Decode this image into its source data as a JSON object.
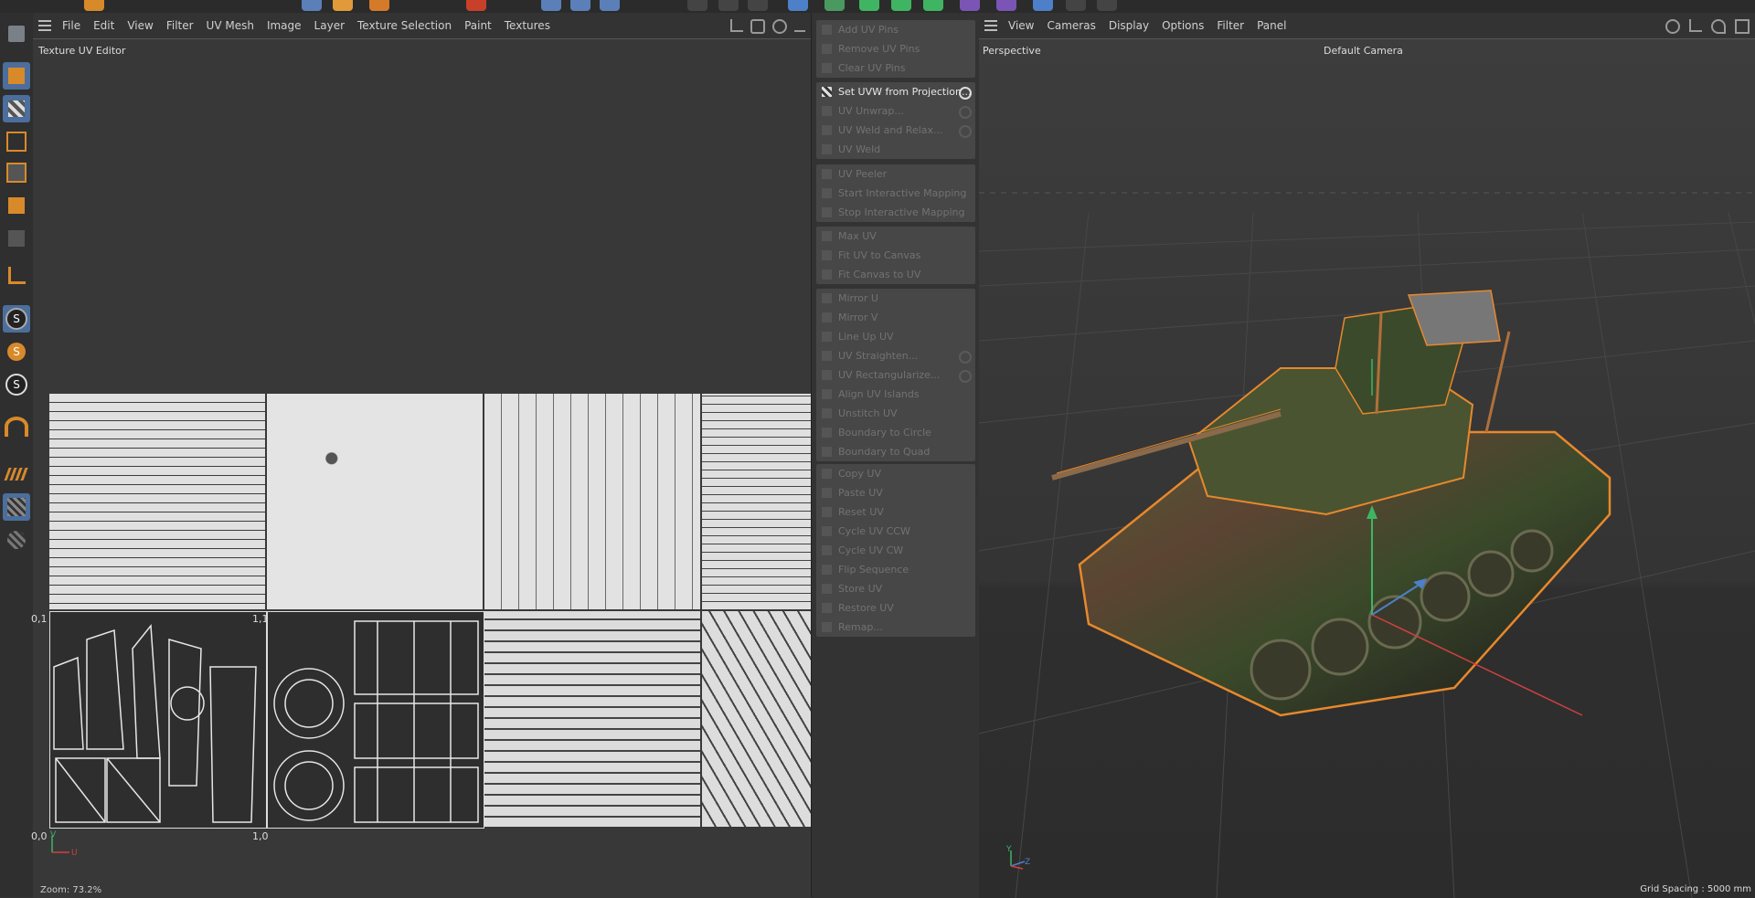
{
  "uv_editor": {
    "menu": [
      "File",
      "Edit",
      "View",
      "Filter",
      "UV Mesh",
      "Image",
      "Layer",
      "Texture Selection",
      "Paint",
      "Textures"
    ],
    "title": "Texture UV Editor",
    "zoom": "Zoom: 73.2%",
    "coords": {
      "origin": "0,0",
      "x1": "1,0",
      "y1": "0,1",
      "xy1": "1,1"
    },
    "axis_u": "U",
    "axis_v": "V"
  },
  "uv_commands": {
    "groups": [
      [
        {
          "label": "Add UV Pins",
          "enabled": false,
          "gear": false
        },
        {
          "label": "Remove UV Pins",
          "enabled": false,
          "gear": false
        },
        {
          "label": "Clear UV Pins",
          "enabled": false,
          "gear": false
        }
      ],
      [
        {
          "label": "Set UVW from Projection...",
          "enabled": true,
          "gear": true
        },
        {
          "label": "UV Unwrap...",
          "enabled": false,
          "gear": true
        },
        {
          "label": "UV Weld and Relax...",
          "enabled": false,
          "gear": true
        },
        {
          "label": "UV Weld",
          "enabled": false,
          "gear": false
        }
      ],
      [
        {
          "label": "UV Peeler",
          "enabled": false,
          "gear": false
        },
        {
          "label": "Start Interactive Mapping",
          "enabled": false,
          "gear": false
        },
        {
          "label": "Stop Interactive Mapping",
          "enabled": false,
          "gear": false
        }
      ],
      [
        {
          "label": "Max UV",
          "enabled": false,
          "gear": false
        },
        {
          "label": "Fit UV to Canvas",
          "enabled": false,
          "gear": false
        },
        {
          "label": "Fit Canvas to UV",
          "enabled": false,
          "gear": false
        }
      ],
      [
        {
          "label": "Mirror U",
          "enabled": false,
          "gear": false
        },
        {
          "label": "Mirror V",
          "enabled": false,
          "gear": false
        },
        {
          "label": "Line Up UV",
          "enabled": false,
          "gear": false
        },
        {
          "label": "UV Straighten...",
          "enabled": false,
          "gear": true
        },
        {
          "label": "UV Rectangularize...",
          "enabled": false,
          "gear": true
        },
        {
          "label": "Align UV Islands",
          "enabled": false,
          "gear": false
        },
        {
          "label": "Unstitch UV",
          "enabled": false,
          "gear": false
        },
        {
          "label": "Boundary to Circle",
          "enabled": false,
          "gear": false
        },
        {
          "label": "Boundary to Quad",
          "enabled": false,
          "gear": false
        }
      ],
      [
        {
          "label": "Copy UV",
          "enabled": false,
          "gear": false
        },
        {
          "label": "Paste UV",
          "enabled": false,
          "gear": false
        },
        {
          "label": "Reset UV",
          "enabled": false,
          "gear": false
        },
        {
          "label": "Cycle UV CCW",
          "enabled": false,
          "gear": false
        },
        {
          "label": "Cycle UV CW",
          "enabled": false,
          "gear": false
        },
        {
          "label": "Flip Sequence",
          "enabled": false,
          "gear": false
        },
        {
          "label": "Store UV",
          "enabled": false,
          "gear": false
        },
        {
          "label": "Restore UV",
          "enabled": false,
          "gear": false
        },
        {
          "label": "Remap...",
          "enabled": false,
          "gear": false
        }
      ]
    ]
  },
  "viewport": {
    "menu": [
      "View",
      "Cameras",
      "Display",
      "Options",
      "Filter",
      "Panel"
    ],
    "view_name": "Perspective",
    "camera": "Default Camera",
    "grid_spacing": "Grid Spacing : 5000 mm",
    "axis_labels": {
      "y": "Y",
      "z": "Z"
    }
  },
  "colors": {
    "accent_blue": "#4b6e9c",
    "selection_orange": "#e8882c",
    "disabled_text": "#727272",
    "enabled_text": "#e6e6e6"
  }
}
